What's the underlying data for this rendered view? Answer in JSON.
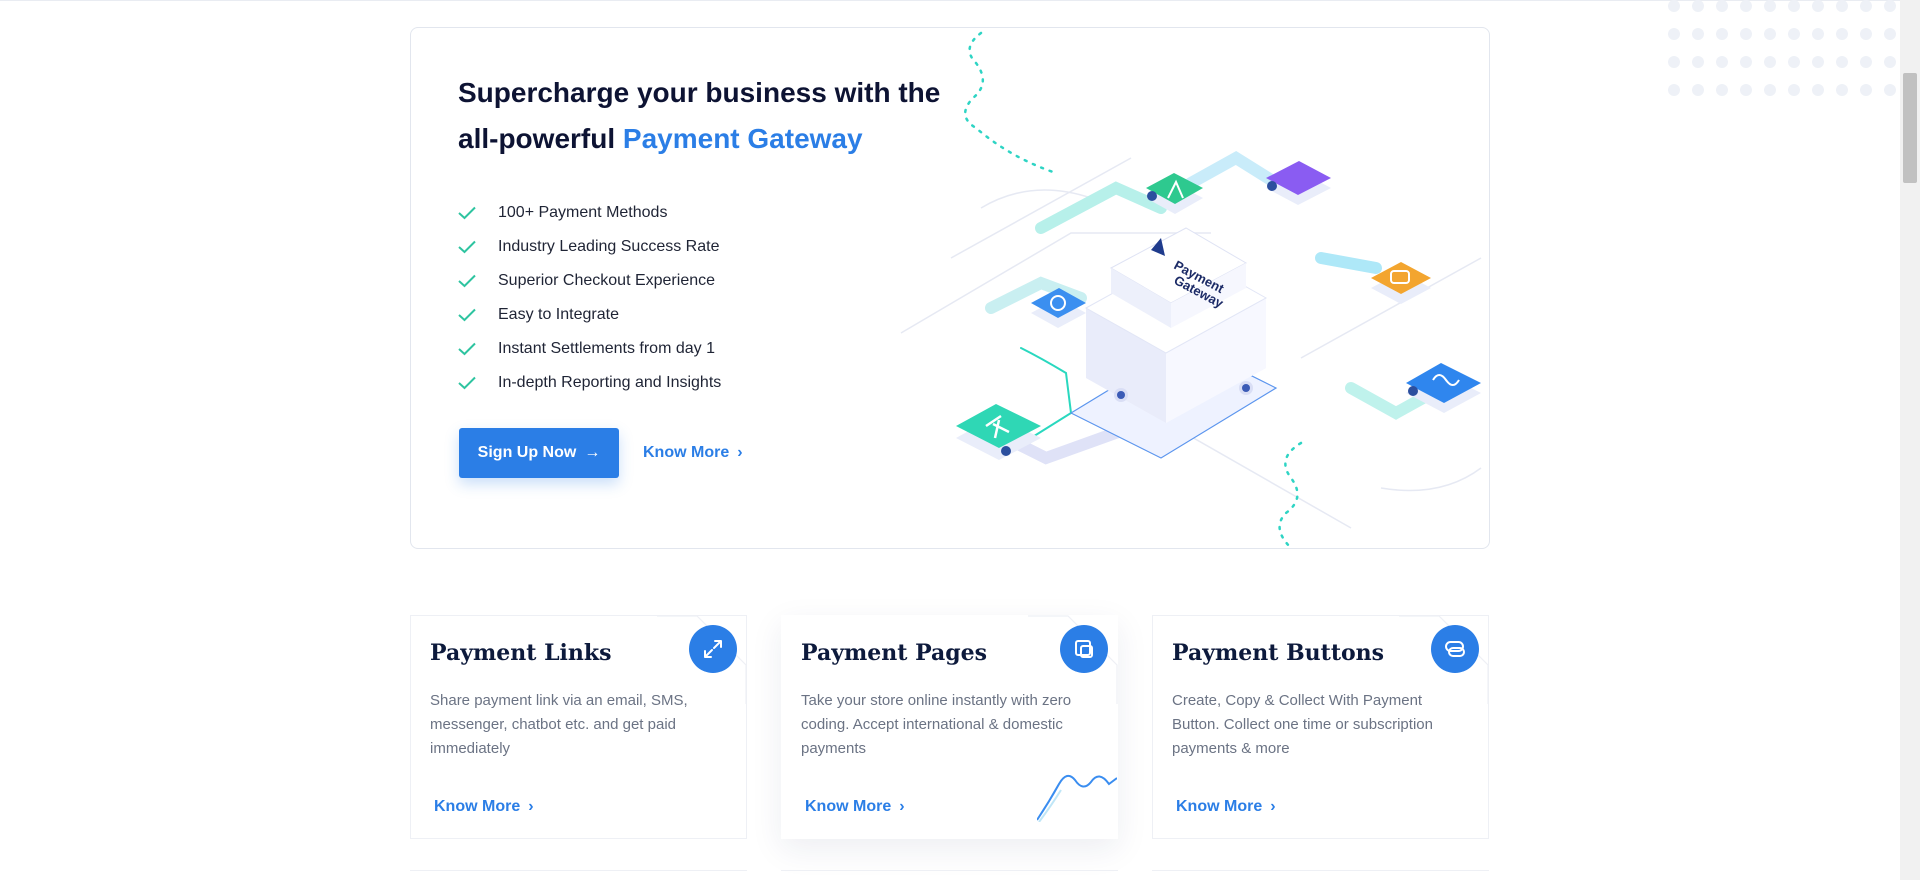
{
  "hero": {
    "title_line1": "Supercharge your business with the",
    "title_line2_prefix": "all-powerful",
    "title_line2_accent": "Payment Gateway",
    "features": [
      "100+ Payment Methods",
      "Industry Leading Success Rate",
      "Superior Checkout Experience",
      "Easy to Integrate",
      "Instant Settlements from day 1",
      "In-depth Reporting and Insights"
    ],
    "cta_primary": "Sign Up Now",
    "cta_secondary": "Know More",
    "illustration_label": "Payment Gateway"
  },
  "products": [
    {
      "title": "Payment Links",
      "description": "Share payment link via an email, SMS, messenger, chatbot etc. and get paid immediately",
      "link": "Know More",
      "icon": "link-arrows-icon"
    },
    {
      "title": "Payment Pages",
      "description": "Take your store online instantly with zero coding. Accept international & domestic payments",
      "link": "Know More",
      "icon": "pages-icon"
    },
    {
      "title": "Payment Buttons",
      "description": "Create, Copy & Collect With Payment Button. Collect one time or subscription payments & more",
      "link": "Know More",
      "icon": "button-icon"
    }
  ],
  "colors": {
    "accent": "#2b7ee6",
    "heading": "#0d1333",
    "check": "#2ec4a0",
    "body_text": "#6b7384"
  }
}
